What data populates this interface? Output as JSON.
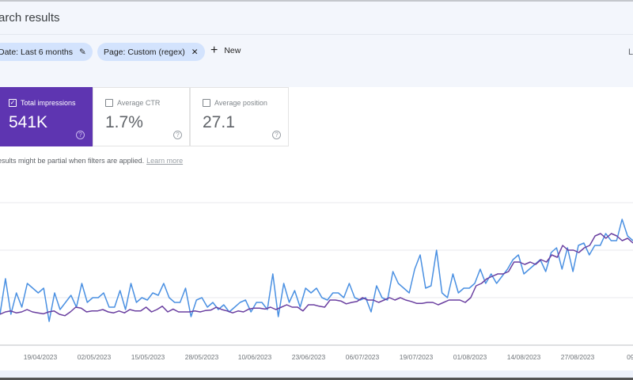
{
  "header": {
    "title": "arch results"
  },
  "filters": {
    "date_chip": "Date: Last 6 months",
    "page_chip": "Page: Custom (regex)",
    "new_label": "New",
    "edge_text": "L"
  },
  "metrics": [
    {
      "label": "Total impressions",
      "value": "541K",
      "checked": true
    },
    {
      "label": "Average CTR",
      "value": "1.7%",
      "checked": false
    },
    {
      "label": "Average position",
      "value": "27.1",
      "checked": false
    }
  ],
  "notice": {
    "text": "esults might be partial when filters are applied.",
    "link": "Learn more"
  },
  "colors": {
    "accent": "#5e35b1",
    "impressions_line": "#4a90e2",
    "purple_line": "#6a3fa0"
  },
  "chart_data": {
    "type": "line",
    "grid": true,
    "y_gridlines": [
      1,
      2,
      3
    ],
    "ylim": [
      0,
      3
    ],
    "xlabel": "",
    "ylabel": "",
    "tick_labels": [
      "3",
      "19/04/2023",
      "02/05/2023",
      "15/05/2023",
      "28/05/2023",
      "10/06/2023",
      "23/06/2023",
      "06/07/2023",
      "19/07/2023",
      "01/08/2023",
      "14/08/2023",
      "27/08/2023",
      "09/"
    ],
    "series": [
      {
        "color": "#4a90e2",
        "values": [
          0.65,
          1.4,
          0.65,
          1.1,
          0.8,
          1.3,
          1.2,
          1.1,
          1.2,
          0.5,
          1.1,
          0.75,
          0.9,
          1.05,
          0.8,
          1.3,
          0.9,
          1.0,
          1.0,
          1.1,
          0.8,
          0.8,
          1.15,
          0.75,
          1.3,
          0.9,
          1.0,
          0.95,
          1.1,
          1.05,
          1.3,
          1.0,
          0.9,
          0.9,
          1.2,
          0.6,
          0.95,
          1.0,
          0.8,
          0.9,
          0.75,
          0.85,
          0.7,
          0.8,
          0.9,
          0.95,
          0.7,
          0.9,
          0.9,
          0.75,
          1.5,
          0.6,
          1.3,
          0.9,
          1.15,
          0.8,
          1.2,
          1.1,
          1.2,
          1.0,
          0.95,
          1.1,
          1.1,
          1.0,
          1.3,
          1.0,
          0.95,
          1.0,
          0.7,
          1.25,
          1.0,
          0.95,
          1.55,
          1.3,
          1.2,
          1.1,
          1.6,
          1.9,
          1.2,
          1.25,
          2.0,
          1.1,
          1.0,
          1.5,
          1.1,
          1.2,
          1.2,
          1.3,
          1.6,
          1.3,
          1.5,
          1.3,
          1.45,
          1.6,
          1.8,
          1.9,
          1.5,
          1.6,
          1.7,
          1.8,
          1.55,
          1.95,
          2.05,
          1.6,
          2.05,
          1.55,
          2.1,
          2.15,
          1.9,
          2.1,
          2.1,
          2.35,
          2.2,
          2.2,
          2.65,
          2.3,
          2.2
        ]
      },
      {
        "color": "#6a3fa0",
        "values": [
          0.65,
          0.7,
          0.72,
          0.68,
          0.7,
          0.75,
          0.7,
          0.68,
          0.66,
          0.7,
          0.72,
          0.65,
          0.62,
          0.7,
          0.8,
          0.78,
          0.7,
          0.72,
          0.72,
          0.75,
          0.7,
          0.68,
          0.72,
          0.68,
          0.75,
          0.72,
          0.72,
          0.8,
          0.7,
          0.75,
          0.82,
          0.7,
          0.76,
          0.7,
          0.7,
          0.7,
          0.72,
          0.7,
          0.73,
          0.74,
          0.8,
          0.75,
          0.72,
          0.68,
          0.72,
          0.7,
          0.76,
          0.78,
          0.78,
          0.76,
          0.8,
          0.75,
          0.8,
          0.85,
          0.8,
          0.8,
          0.72,
          0.85,
          0.85,
          0.82,
          0.8,
          0.95,
          0.95,
          0.93,
          0.87,
          0.9,
          0.92,
          1.0,
          0.95,
          0.95,
          0.9,
          0.95,
          1.0,
          0.95,
          1.0,
          0.95,
          0.92,
          0.88,
          0.88,
          0.9,
          0.9,
          0.85,
          0.9,
          0.95,
          0.95,
          0.95,
          0.9,
          1.0,
          1.25,
          1.3,
          1.4,
          1.45,
          1.5,
          1.5,
          1.55,
          1.75,
          1.75,
          1.7,
          1.75,
          1.7,
          1.8,
          1.75,
          1.9,
          1.85,
          2.1,
          2.0,
          2.0,
          1.95,
          2.05,
          2.1,
          2.3,
          2.35,
          2.25,
          2.35,
          2.3,
          2.2,
          2.25,
          2.15
        ]
      }
    ]
  }
}
